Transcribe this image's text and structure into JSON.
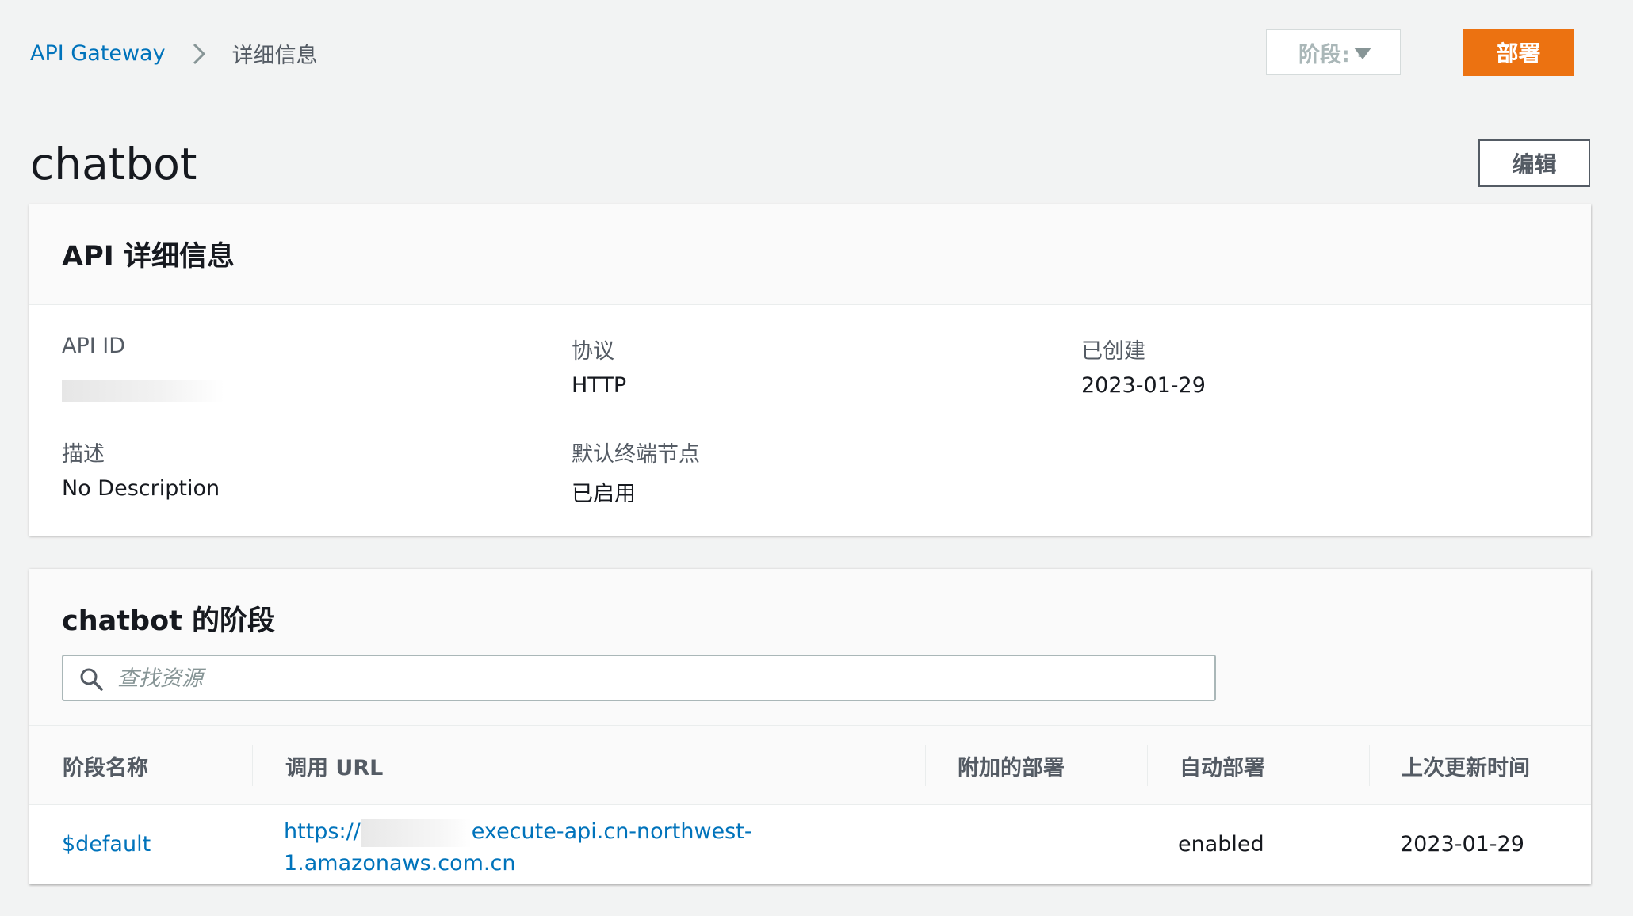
{
  "breadcrumb": {
    "root": "API Gateway",
    "current": "详细信息"
  },
  "stage_select": {
    "label": "阶段: -"
  },
  "deploy_button": "部署",
  "page_title": "chatbot",
  "edit_button": "编辑",
  "details": {
    "title": "API 详细信息",
    "api_id_label": "API ID",
    "protocol_label": "协议",
    "protocol_value": "HTTP",
    "created_label": "已创建",
    "created_value": "2023-01-29",
    "description_label": "描述",
    "description_value": "No Description",
    "default_endpoint_label": "默认终端节点",
    "default_endpoint_value": "已启用"
  },
  "stages": {
    "title": "chatbot 的阶段",
    "search_placeholder": "查找资源",
    "columns": {
      "name": "阶段名称",
      "invoke_url": "调用 URL",
      "attached_deployment": "附加的部署",
      "auto_deploy": "自动部署",
      "last_updated": "上次更新时间"
    },
    "rows": [
      {
        "name": "$default",
        "url_line1_prefix": "https://",
        "url_line1_suffix": "execute-api.cn-northwest-",
        "url_line2": "1.amazonaws.com.cn",
        "attached_deployment": "",
        "auto_deploy": "enabled",
        "last_updated": "2023-01-29"
      }
    ]
  },
  "colors": {
    "link": "#0073bb",
    "primary_button": "#ec7211",
    "background": "#f2f3f3"
  }
}
